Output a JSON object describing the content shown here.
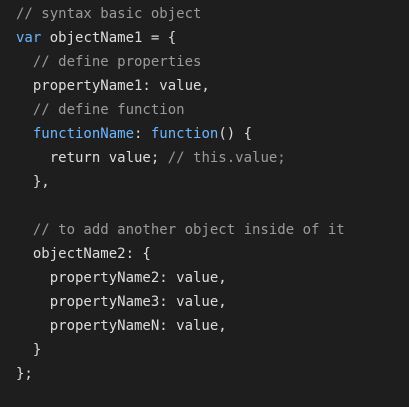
{
  "colors": {
    "background": "#1e1e1e",
    "plain": "#dcdcdc",
    "comment": "#9a9a9a",
    "keyword": "#6cb6ff"
  },
  "lines": [
    {
      "indent": 0,
      "tokens": [
        {
          "type": "comment",
          "text": "// syntax basic object"
        }
      ]
    },
    {
      "indent": 0,
      "tokens": [
        {
          "type": "keyword",
          "text": "var"
        },
        {
          "type": "plain",
          "text": " objectName1 = {"
        }
      ]
    },
    {
      "indent": 1,
      "tokens": [
        {
          "type": "comment",
          "text": "// define properties"
        }
      ]
    },
    {
      "indent": 1,
      "tokens": [
        {
          "type": "plain",
          "text": "propertyName1: value,"
        }
      ]
    },
    {
      "indent": 1,
      "tokens": [
        {
          "type": "comment",
          "text": "// define function"
        }
      ]
    },
    {
      "indent": 1,
      "tokens": [
        {
          "type": "function",
          "text": "functionName"
        },
        {
          "type": "plain",
          "text": ": "
        },
        {
          "type": "keyword",
          "text": "function"
        },
        {
          "type": "plain",
          "text": "() {"
        }
      ]
    },
    {
      "indent": 2,
      "tokens": [
        {
          "type": "plain",
          "text": "return value; "
        },
        {
          "type": "comment",
          "text": "// this.value;"
        }
      ]
    },
    {
      "indent": 1,
      "tokens": [
        {
          "type": "plain",
          "text": "},"
        }
      ]
    },
    {
      "indent": 0,
      "tokens": []
    },
    {
      "indent": 1,
      "tokens": [
        {
          "type": "comment",
          "text": "// to add another object inside of it"
        }
      ]
    },
    {
      "indent": 1,
      "tokens": [
        {
          "type": "plain",
          "text": "objectName2: {"
        }
      ]
    },
    {
      "indent": 2,
      "tokens": [
        {
          "type": "plain",
          "text": "propertyName2: value,"
        }
      ]
    },
    {
      "indent": 2,
      "tokens": [
        {
          "type": "plain",
          "text": "propertyName3: value,"
        }
      ]
    },
    {
      "indent": 2,
      "tokens": [
        {
          "type": "plain",
          "text": "propertyNameN: value,"
        }
      ]
    },
    {
      "indent": 1,
      "tokens": [
        {
          "type": "plain",
          "text": "}"
        }
      ]
    },
    {
      "indent": 0,
      "tokens": [
        {
          "type": "plain",
          "text": "};"
        }
      ]
    }
  ]
}
